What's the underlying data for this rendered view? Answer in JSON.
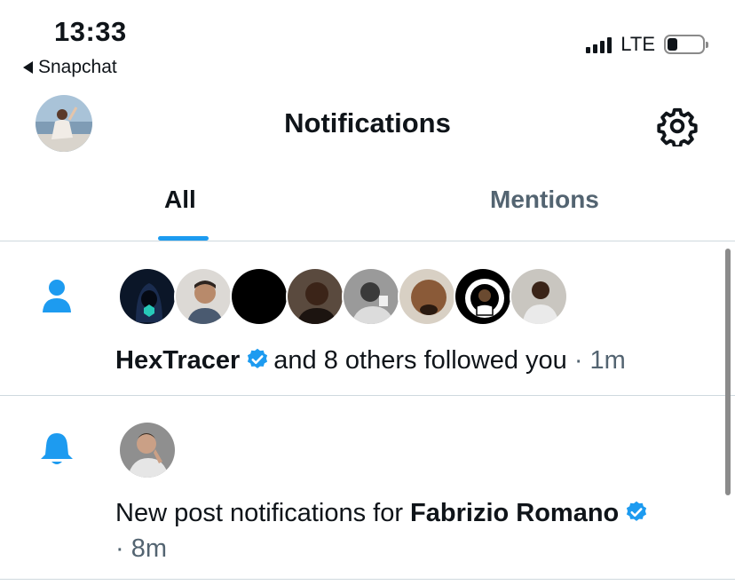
{
  "status": {
    "time": "13:33",
    "back_app": "Snapchat",
    "network": "LTE",
    "battery_level": 0.28
  },
  "header": {
    "title": "Notifications",
    "settings_icon": "gear-icon",
    "profile_icon": "avatar"
  },
  "tabs": [
    {
      "label": "All",
      "active": true
    },
    {
      "label": "Mentions",
      "active": false
    }
  ],
  "notifications": [
    {
      "type": "follow",
      "icon": "person-icon",
      "user": "HexTracer",
      "text": "and 8 others followed you",
      "time": "· 1m"
    },
    {
      "type": "post-notification",
      "icon": "bell-icon",
      "prefix": "New post notifications for",
      "user": "Fabrizio Romano",
      "time": "· 8m"
    }
  ],
  "colors": {
    "accent": "#1d9bf0",
    "text": "#0f1419",
    "muted": "#536471",
    "divider": "#cfd9de"
  }
}
